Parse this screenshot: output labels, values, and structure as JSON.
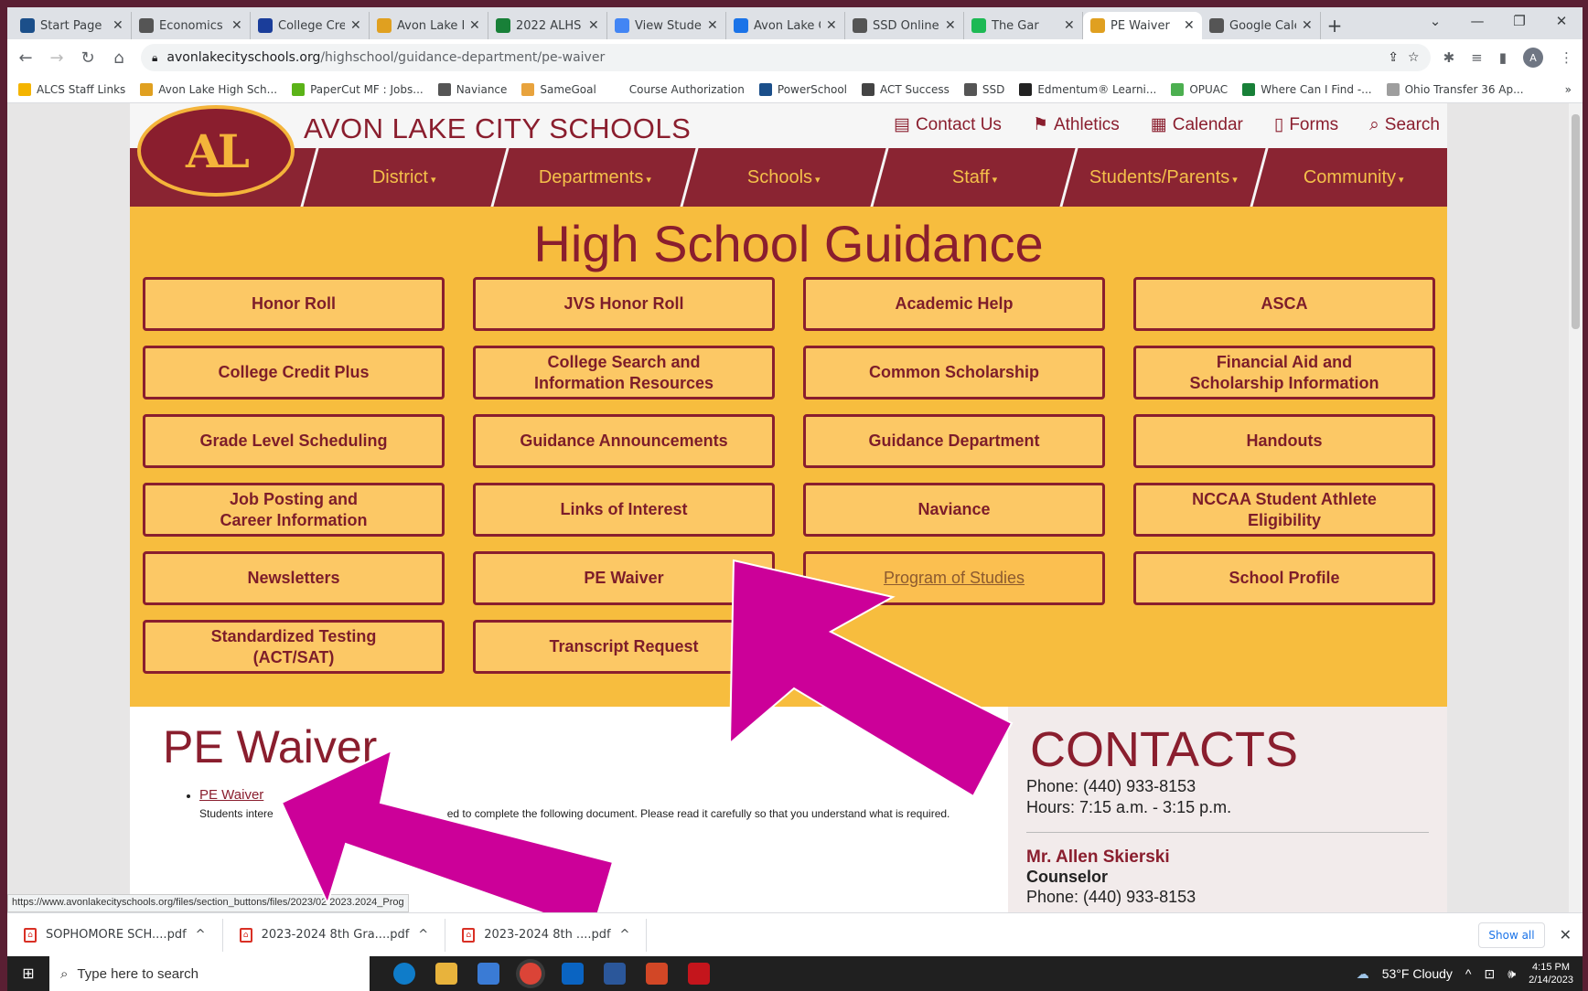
{
  "browser": {
    "tabs": [
      {
        "label": "Start Page",
        "icon": "sis-icon",
        "color": "#1b4f8a",
        "active": false
      },
      {
        "label": "Economics (",
        "icon": "globe-icon",
        "color": "#555555",
        "active": false
      },
      {
        "label": "College Cre",
        "icon": "ccp-icon",
        "color": "#1a3d9a",
        "active": false
      },
      {
        "label": "Avon Lake H",
        "icon": "shoremen-icon",
        "color": "#e0a020",
        "active": false
      },
      {
        "label": "2022 ALHS (",
        "icon": "sheets-icon",
        "color": "#188038",
        "active": false
      },
      {
        "label": "View Studen",
        "icon": "chrome-icon",
        "color": "#4285f4",
        "active": false
      },
      {
        "label": "Avon Lake C",
        "icon": "calendar-icon",
        "color": "#1a73e8",
        "active": false
      },
      {
        "label": "SSD Online",
        "icon": "shield-icon",
        "color": "#555555",
        "active": false
      },
      {
        "label": "The Gar",
        "icon": "spotify-icon",
        "color": "#1db954",
        "active": false
      },
      {
        "label": "PE Waiver",
        "icon": "shoremen-icon",
        "color": "#e0a020",
        "active": true
      },
      {
        "label": "Google Cale",
        "icon": "globe-icon",
        "color": "#555555",
        "active": false
      }
    ],
    "url_host": "avonlakecityschools.org",
    "url_path": "/highschool/guidance-department/pe-waiver",
    "profile_initial": "A",
    "bookmarks": [
      {
        "label": "ALCS Staff Links",
        "color": "#f4b400"
      },
      {
        "label": "Avon Lake High Sch...",
        "color": "#e0a020"
      },
      {
        "label": "PaperCut MF : Jobs...",
        "color": "#5bb318"
      },
      {
        "label": "Naviance",
        "color": "#555555"
      },
      {
        "label": "SameGoal",
        "color": "#e8a33d"
      },
      {
        "label": "Course Authorization",
        "color": "#ffffff"
      },
      {
        "label": "PowerSchool",
        "color": "#1b4f8a"
      },
      {
        "label": "ACT Success",
        "color": "#444444"
      },
      {
        "label": "SSD",
        "color": "#555555"
      },
      {
        "label": "Edmentum® Learni...",
        "color": "#222222"
      },
      {
        "label": "OPUAC",
        "color": "#4caf50"
      },
      {
        "label": "Where Can I Find -...",
        "color": "#188038"
      },
      {
        "label": "Ohio Transfer 36 Ap...",
        "color": "#9e9e9e"
      }
    ]
  },
  "site": {
    "logo_text": "AL",
    "name": "AVON LAKE CITY SCHOOLS",
    "top_links": [
      {
        "label": "Contact Us",
        "icon": "contact-card-icon"
      },
      {
        "label": "Athletics",
        "icon": "runner-icon"
      },
      {
        "label": "Calendar",
        "icon": "calendar-icon"
      },
      {
        "label": "Forms",
        "icon": "document-icon"
      },
      {
        "label": "Search",
        "icon": "search-icon"
      }
    ],
    "nav": [
      "District",
      "Departments",
      "Schools",
      "Staff",
      "Students/Parents",
      "Community"
    ],
    "heading": "High School Guidance",
    "buttons": [
      "Honor Roll",
      "JVS Honor Roll",
      "Academic Help",
      "ASCA",
      "College Credit Plus",
      "College Search and\nInformation Resources",
      "Common Scholarship",
      "Financial Aid and\nScholarship Information",
      "Grade Level Scheduling",
      "Guidance Announcements",
      "Guidance Department",
      "Handouts",
      "Job Posting and\nCareer Information",
      "Links of Interest",
      "Naviance",
      "NCCAA Student Athlete\nEligibility",
      "Newsletters",
      "PE Waiver",
      "Program of Studies",
      "School Profile",
      "Standardized Testing\n(ACT/SAT)",
      "Transcript Request"
    ],
    "hovered_button": "Program of Studies",
    "page_title": "PE Waiver",
    "link_label": "PE Waiver",
    "link_desc_start": "Students intere",
    "link_desc_end": "ed to complete the following document. Please read it carefully so that you understand what is required.",
    "contacts": {
      "title": "CONTACTS",
      "phone": "Phone: (440) 933-8153",
      "hours": "Hours: 7:15 a.m. - 3:15 p.m.",
      "person_name": "Mr. Allen Skierski",
      "person_role": "Counselor",
      "person_phone": "Phone: (440) 933-8153"
    },
    "status_url": "https://www.avonlakecityschools.org/files/section_buttons/files/2023/02/2023.2024_Prog",
    "colors": {
      "maroon": "#8a1e2e",
      "gold": "#f7bd3e",
      "arrow": "#cc0099"
    }
  },
  "downloads": {
    "items": [
      "SOPHOMORE SCH....pdf",
      "2023-2024 8th Gra....pdf",
      "2023-2024 8th ....pdf"
    ],
    "show_all": "Show all"
  },
  "taskbar": {
    "search_placeholder": "Type here to search",
    "weather": "53°F  Cloudy",
    "time": "4:15 PM",
    "date": "2/14/2023"
  }
}
